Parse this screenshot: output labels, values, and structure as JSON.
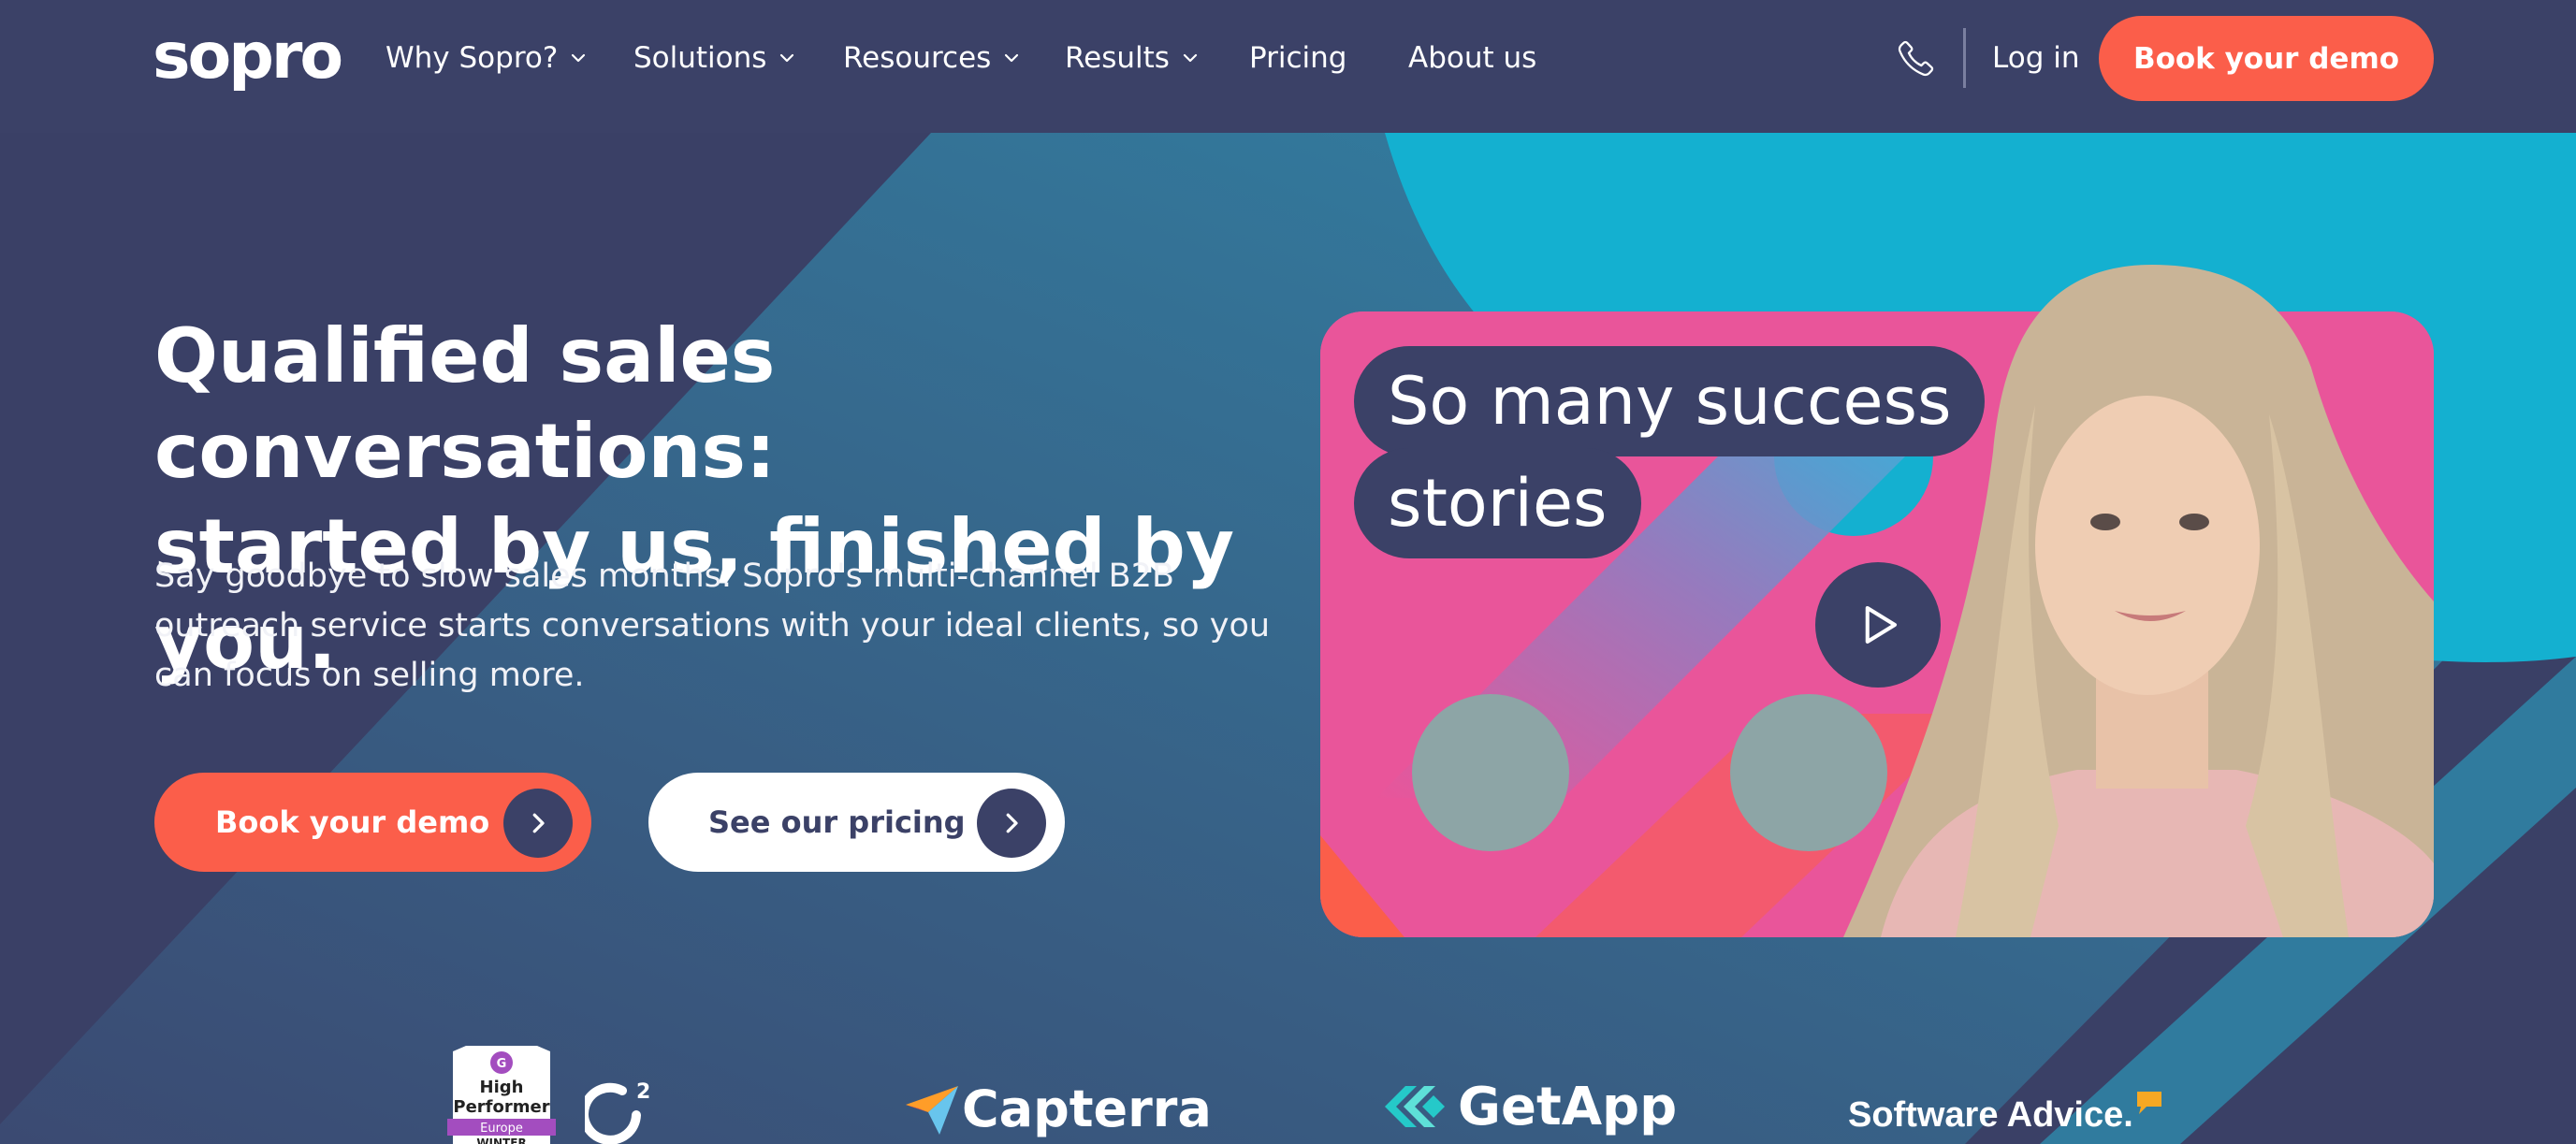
{
  "colors": {
    "navy": "#3b4167",
    "coral": "#fb5e4a",
    "teal": "#14b0d0",
    "pink": "#e9559a",
    "white": "#ffffff"
  },
  "nav": {
    "logo": "sopro",
    "items": [
      {
        "label": "Why Sopro?",
        "dropdown": true
      },
      {
        "label": "Solutions",
        "dropdown": true
      },
      {
        "label": "Resources",
        "dropdown": true
      },
      {
        "label": "Results",
        "dropdown": true
      },
      {
        "label": "Pricing",
        "dropdown": false
      },
      {
        "label": "About us",
        "dropdown": false
      }
    ],
    "phone_icon": "phone-icon",
    "login_label": "Log in",
    "cta_label": "Book your demo"
  },
  "hero": {
    "headline_line1": "Qualified sales conversations:",
    "headline_line2": "started by us, finished by you.",
    "subtext_line1": "Say goodbye to slow sales months. Sopro's multi-channel B2B",
    "subtext_line2": "outreach service starts conversations with your ideal clients, so you",
    "subtext_line3": "can focus on selling more.",
    "primary_button": "Book your demo",
    "secondary_button": "See our pricing"
  },
  "video": {
    "bubble_line1": "So many success",
    "bubble_line2": "stories",
    "play_icon": "play-icon"
  },
  "logos": {
    "g2_badge_line1": "High",
    "g2_badge_line2": "Performer",
    "g2_badge_region": "Europe",
    "g2_badge_season": "WINTER",
    "capterra": "Capterra",
    "getapp": "GetApp",
    "software_advice": "Software Advice."
  }
}
